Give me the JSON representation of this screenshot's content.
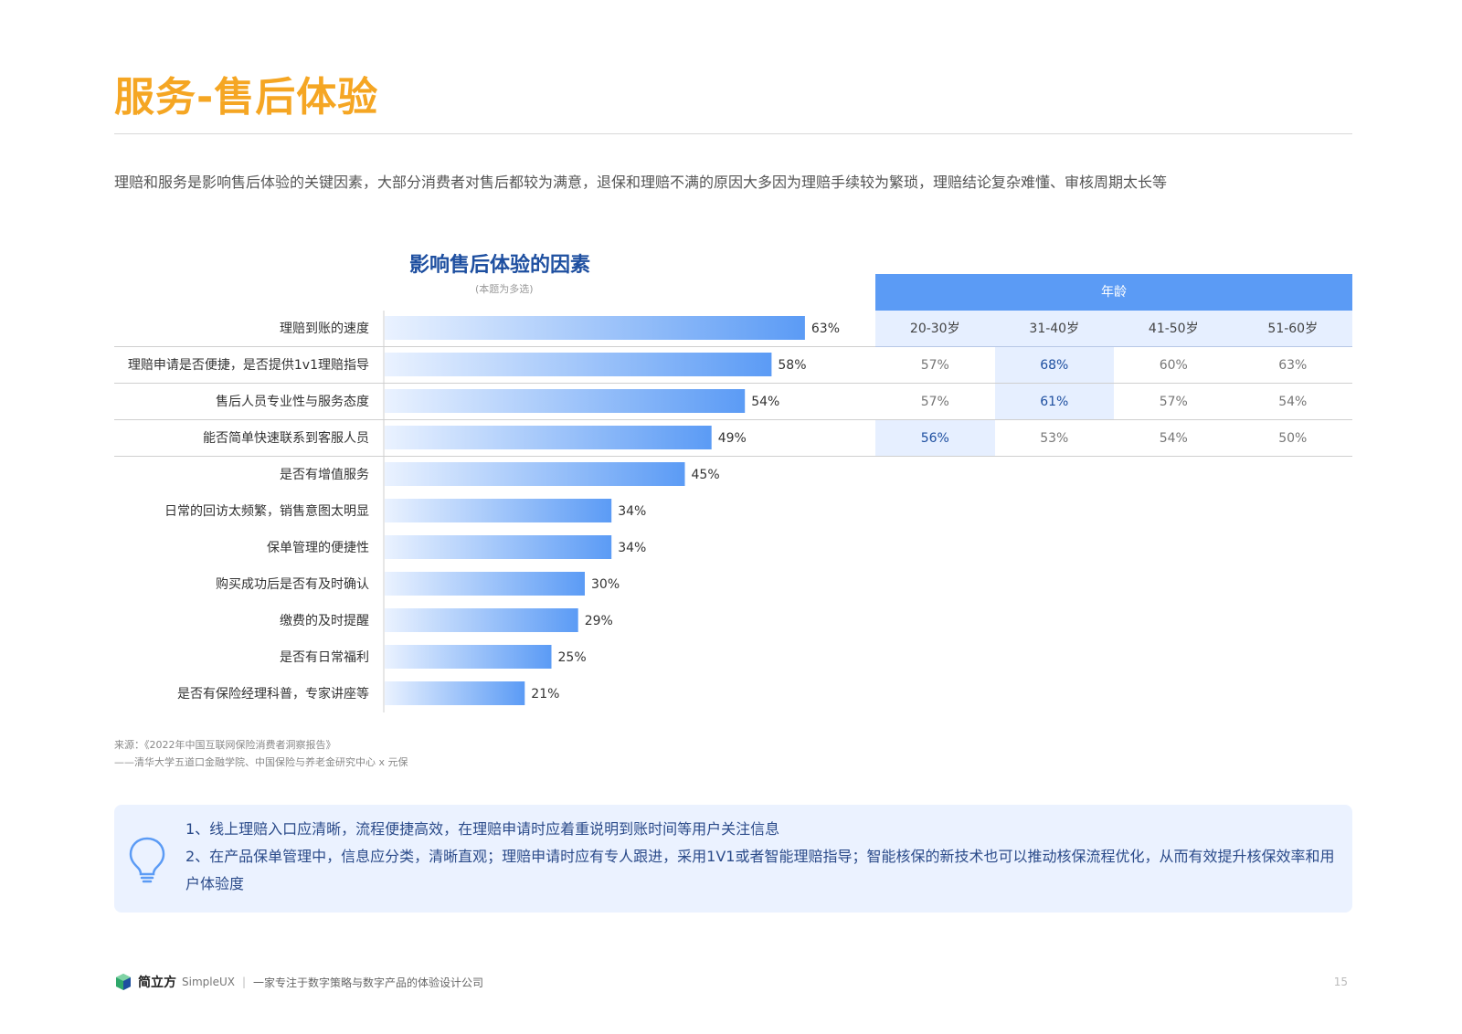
{
  "page": {
    "title": "服务-售后体验",
    "intro": "理赔和服务是影响售后体验的关键因素，大部分消费者对售后都较为满意，退保和理赔不满的原因大多因为理赔手续较为繁琐，理赔结论复杂难懂、审核周期太长等",
    "source_line1": "来源：《2022年中国互联网保险消费者洞察报告》",
    "source_line2": "——清华大学五道口金融学院、中国保险与养老金研究中心 x 元保",
    "page_number": "15"
  },
  "chart_data": {
    "type": "bar",
    "orientation": "horizontal",
    "title": "影响售后体验的因素",
    "subtitle": "(本题为多选)",
    "categories": [
      "理赔到账的速度",
      "理赔申请是否便捷，是否提供1v1理赔指导",
      "售后人员专业性与服务态度",
      "能否简单快速联系到客服人员",
      "是否有增值服务",
      "日常的回访太频繁，销售意图太明显",
      "保单管理的便捷性",
      "购买成功后是否有及时确认",
      "缴费的及时提醒",
      "是否有日常福利",
      "是否有保险经理科普，专家讲座等"
    ],
    "values": [
      63,
      58,
      54,
      49,
      45,
      34,
      34,
      30,
      29,
      25,
      21
    ],
    "value_labels": [
      "63%",
      "58%",
      "54%",
      "49%",
      "45%",
      "34%",
      "34%",
      "30%",
      "29%",
      "25%",
      "21%"
    ],
    "xlim": [
      0,
      100
    ],
    "grid": false,
    "bar_color_start": "#eaf2ff",
    "bar_color_end": "#5b9bf5"
  },
  "age_table": {
    "header": "年龄",
    "columns": [
      "20-30岁",
      "31-40岁",
      "41-50岁",
      "51-60岁"
    ],
    "rows": [
      [
        "57%",
        "68%",
        "60%",
        "63%"
      ],
      [
        "57%",
        "61%",
        "57%",
        "54%"
      ],
      [
        "56%",
        "53%",
        "54%",
        "50%"
      ]
    ],
    "highlight": [
      [
        0,
        1
      ],
      [
        1,
        1
      ],
      [
        2,
        0
      ]
    ],
    "header_color": "#5b9bf5",
    "highlight_color": "#1e4fa0"
  },
  "tips": {
    "icon": "lightbulb-icon",
    "line1": "1、线上理赔入口应清晰，流程便捷高效，在理赔申请时应着重说明到账时间等用户关注信息",
    "line2": "2、在产品保单管理中，信息应分类，清晰直观；理赔申请时应有专人跟进，采用1V1或者智能理赔指导；智能核保的新技术也可以推动核保流程优化，从而有效提升核保效率和用户体验度"
  },
  "footer": {
    "brand_cn": "简立方",
    "brand_en": "SimpleUX",
    "separator": "|",
    "tagline": "一家专注于数字策略与数字产品的体验设计公司"
  }
}
